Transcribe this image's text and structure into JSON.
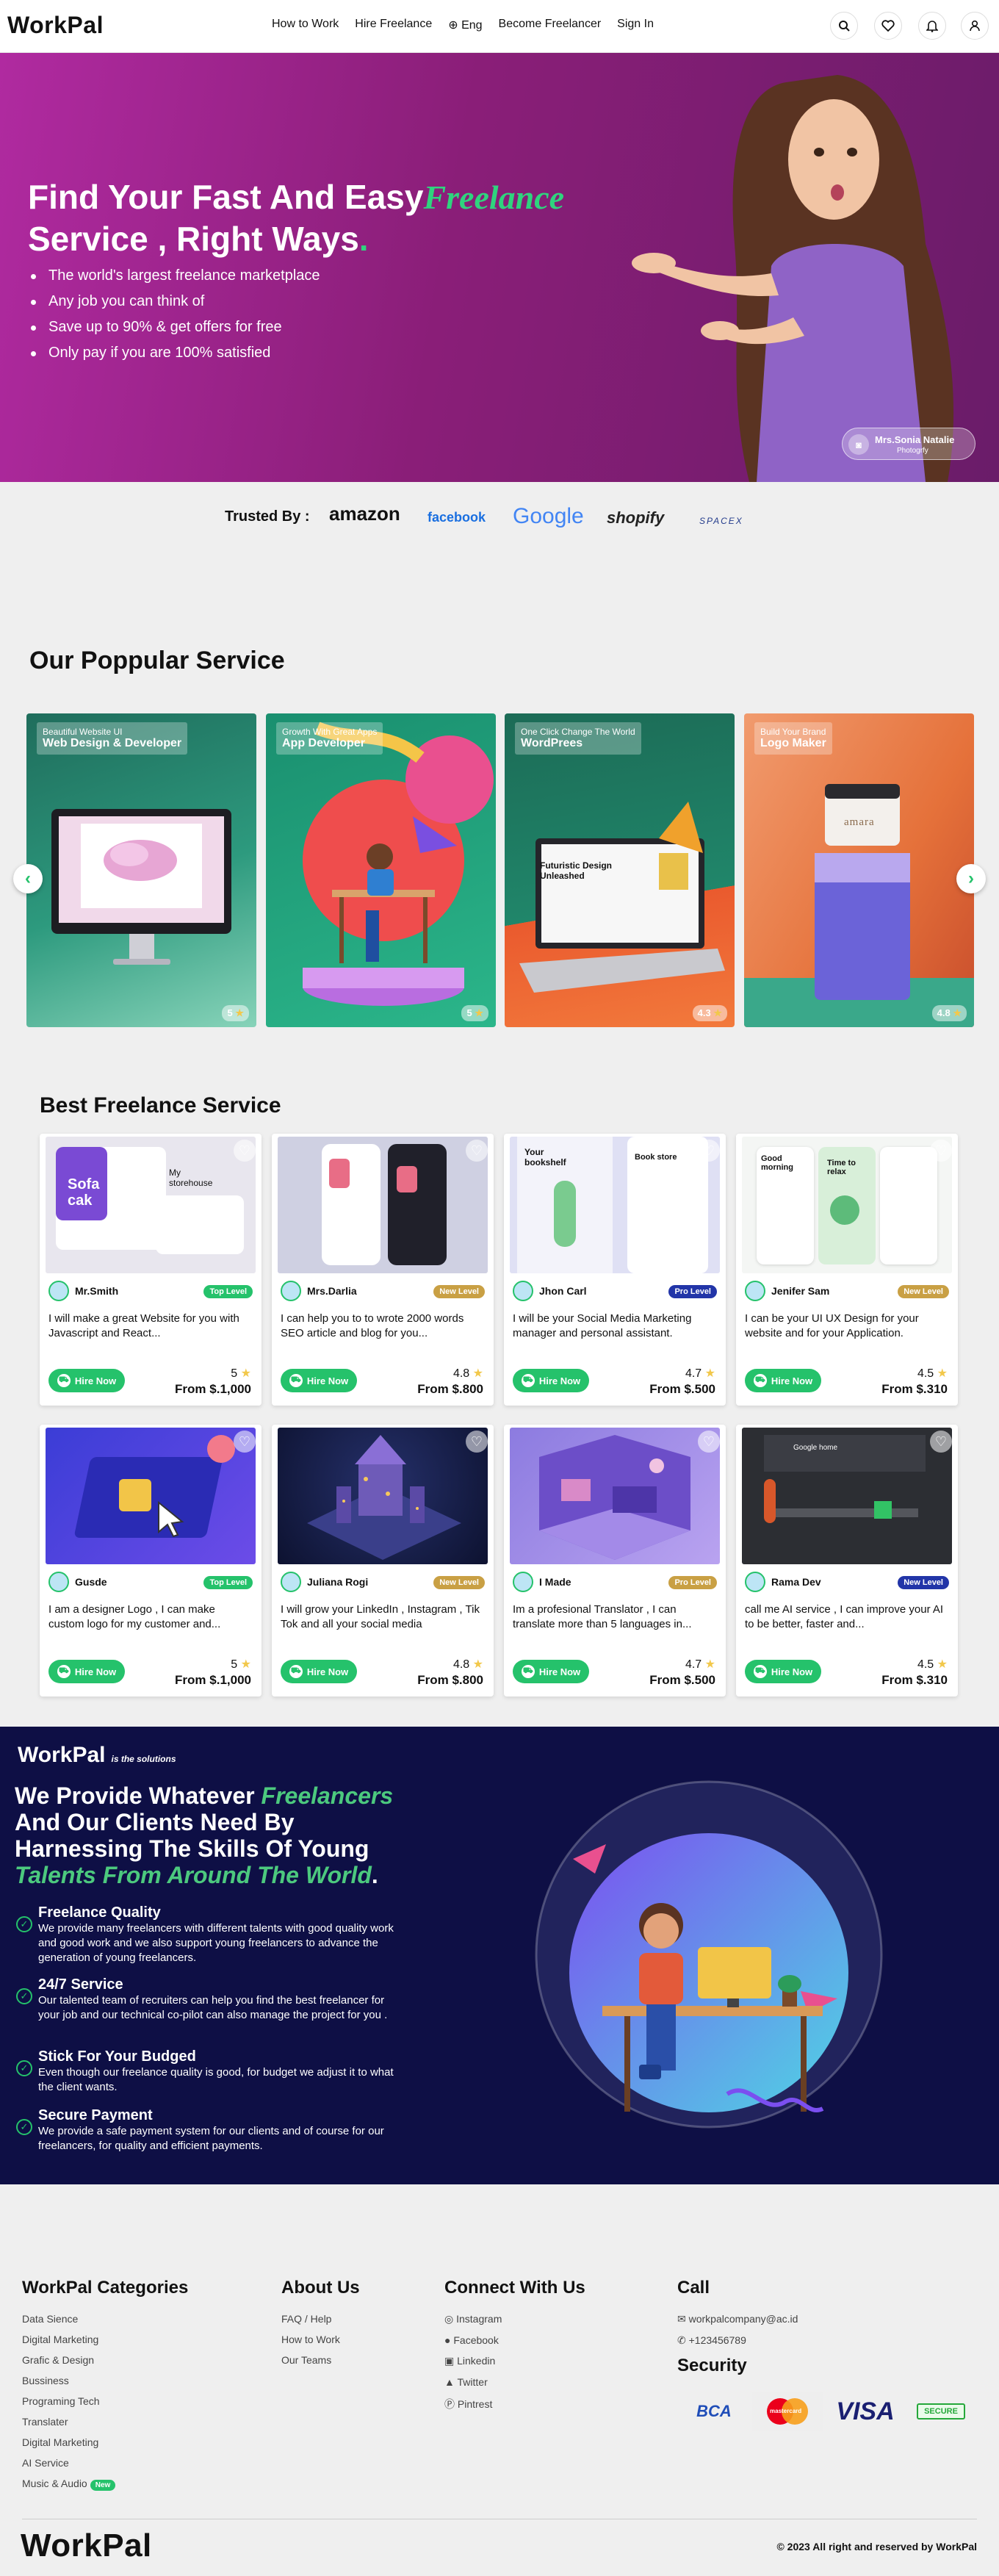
{
  "header": {
    "logo_a": "Wo",
    "logo_b": "rkPal",
    "nav": [
      "How to Work",
      "Hire Freelance",
      "Eng",
      "Become Freelancer",
      "Sign In"
    ],
    "icons": [
      "search-icon",
      "heart-icon",
      "bell-icon",
      "user-icon"
    ]
  },
  "hero": {
    "title_1": "Find Your Fast And Easy",
    "title_accent": "Freelance",
    "title_2": "Service , Right Ways",
    "title_dot": ".",
    "bullets": [
      "The world's largest freelance marketplace",
      "Any job you can think of",
      "Save up to 90% & get offers for free",
      "Only pay if you are 100% satisfied"
    ],
    "badge_name": "Mrs.Sonia Natalie",
    "badge_role": "Photogrfy"
  },
  "trusted": {
    "label": "Trusted By :",
    "brands": [
      "amazon",
      "facebook",
      "Google",
      "shopify",
      "SPACEX"
    ]
  },
  "popular": {
    "title": "Our Poppular Service",
    "cards": [
      {
        "small": "Beautiful Website UI",
        "big": "Web Design & Developer",
        "rating": "5"
      },
      {
        "small": "Growth With Great Apps",
        "big": "App Developer",
        "rating": "5"
      },
      {
        "small": "One Click Change The World",
        "big": "WordPrees",
        "rating": "4.3"
      },
      {
        "small": "Build Your Brand",
        "big": "Logo Maker",
        "rating": "4.8"
      }
    ],
    "card_texts": {
      "futuristic": "Futuristic Design Unleashed",
      "jar": "amara"
    }
  },
  "best": {
    "title": "Best Freelance Service",
    "hire_label": "Hire Now",
    "cards": [
      {
        "name": "Mr.Smith",
        "level": "Top Level",
        "level_color": "#25c26b",
        "desc": "I will make a great Website for you with Javascript and React...",
        "rating": "5",
        "price": "From $.1,000"
      },
      {
        "name": "Mrs.Darlia",
        "level": "New Level",
        "level_color": "#c9a044",
        "desc": "I can help you to to wrote 2000 words SEO article and blog for you...",
        "rating": "4.8",
        "price": "From $.800"
      },
      {
        "name": "Jhon Carl",
        "level": "Pro Level",
        "level_color": "#2235a8",
        "desc": "I will be your Social Media Marketing manager and personal assistant.",
        "rating": "4.7",
        "price": "From $.500"
      },
      {
        "name": "Jenifer Sam",
        "level": "New Level",
        "level_color": "#c9a044",
        "desc": "I can be your UI UX Design for your website and for your Application.",
        "rating": "4.5",
        "price": "From $.310"
      },
      {
        "name": "Gusde",
        "level": "Top Level",
        "level_color": "#25c26b",
        "desc": "I am a designer Logo , I can make custom logo for my customer and...",
        "rating": "5",
        "price": "From $.1,000"
      },
      {
        "name": "Juliana Rogi",
        "level": "New Level",
        "level_color": "#c9a044",
        "desc": "I will grow your LinkedIn , Instagram , Tik Tok and all your social media",
        "rating": "4.8",
        "price": "From $.800"
      },
      {
        "name": "I Made",
        "level": "Pro Level",
        "level_color": "#c9a044",
        "desc": "Im a profesional Translator , I can translate more than 5 languages in...",
        "rating": "4.7",
        "price": "From $.500"
      },
      {
        "name": "Rama Dev",
        "level": "New Level",
        "level_color": "#2235a8",
        "desc": "call me AI service , I can improve your AI to be better, faster and...",
        "rating": "4.5",
        "price": "From $.310"
      }
    ],
    "mockup_texts": {
      "sofa": "Sofa cak",
      "store": "My storehouse",
      "bookshelf": "Your bookshelf",
      "bookstore": "Book store",
      "morning": "Good morning",
      "relax": "Time to relax",
      "google": "Google home"
    }
  },
  "solutions": {
    "logo": "WorkPal",
    "tagline": "is the solutions",
    "h_1": "We Provide Whatever",
    "h_accent1": "Freelancers",
    "h_2": "And Our Clients Need By",
    "h_3": "Harnessing The Skills Of Young",
    "h_accent2": "Talents From Around The World",
    "h_dot": ".",
    "features": [
      {
        "title": "Freelance Quality",
        "desc": "We provide many freelancers with different talents with good quality work and good work and we also support young freelancers to advance the generation of young freelancers."
      },
      {
        "title": "24/7 Service",
        "desc": "Our talented team of recruiters can help you find the best freelancer for your job and our technical co-pilot can also manage the project for you ."
      },
      {
        "title": "Stick For Your Budged",
        "desc": "Even though our freelance quality is good, for budget we adjust it to what the client wants."
      },
      {
        "title": "Secure Payment",
        "desc": "We provide a safe payment system for our clients and of course for our freelancers, for quality and efficient payments."
      }
    ]
  },
  "footer": {
    "categories_title": "WorkPal Categories",
    "categories": [
      "Data Sience",
      "Digital Marketing",
      "Grafic & Design",
      "Bussiness",
      "Programing Tech",
      "Translater",
      "Digital Marketing",
      "AI Service",
      "Music & Audio"
    ],
    "new_badge": "New",
    "about_title": "About Us",
    "about": [
      "FAQ / Help",
      "How to Work",
      "Our Teams"
    ],
    "connect_title": "Connect With Us",
    "connect": [
      "Instagram",
      "Facebook",
      "Linkedin",
      "Twitter",
      "Pintrest"
    ],
    "call_title": "Call",
    "email": "workpalcompany@ac.id",
    "phone": "+123456789",
    "security_title": "Security",
    "payments": [
      "BCA",
      "mastercard",
      "VISA",
      "SECURE"
    ],
    "copyright": "© 2023 All right and reserved by WorkPal"
  },
  "colors": {
    "accent": "#25c26b",
    "hero_purple": "#9b2390",
    "navy": "#0e0f45"
  }
}
